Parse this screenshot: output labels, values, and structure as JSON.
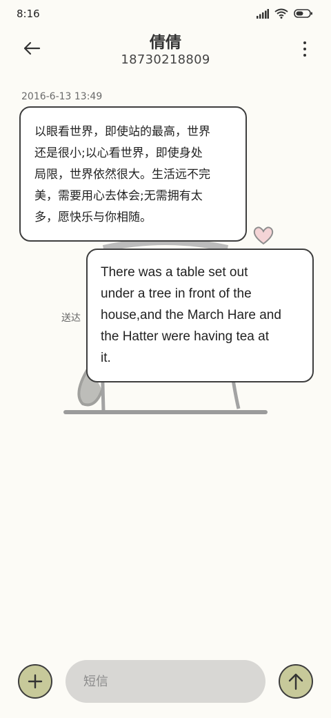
{
  "status_bar": {
    "time": "8:16",
    "icons": [
      "signal-icon",
      "wifi-icon",
      "battery-icon"
    ]
  },
  "header": {
    "contact_name": "倩倩",
    "phone_number": "18730218809",
    "back_icon": "back-arrow-icon",
    "more_icon": "more-vertical-icon"
  },
  "conversation": {
    "timestamp": "2016-6-13 13:49",
    "messages": [
      {
        "direction": "incoming",
        "lines": [
          "以眼看世界，即使站的最高，世界",
          "还是很小;以心看世界，即使身处",
          "局限，世界依然很大。生活远不完",
          "美，需要用心去体会;无需拥有太",
          "多，愿快乐与你相随。"
        ]
      },
      {
        "direction": "outgoing",
        "lines": [
          "There was a table set out",
          "under a tree in front of the",
          "house,and the March Hare and",
          "the Hatter were having tea at",
          "it."
        ],
        "status": "送达"
      }
    ]
  },
  "compose": {
    "placeholder": "短信",
    "value": "",
    "add_icon": "plus-icon",
    "send_icon": "send-arrow-up-icon"
  },
  "colors": {
    "background": "#fcfbf6",
    "bubble_border": "#3d3d3d",
    "button_fill": "#c7c99a",
    "input_fill": "#d8d7d4",
    "heart": "#f4d4d6"
  }
}
